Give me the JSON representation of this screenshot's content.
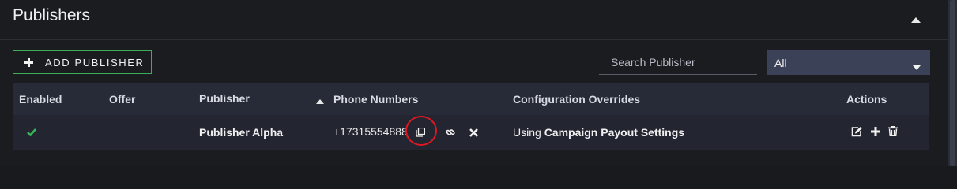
{
  "panel": {
    "title": "Publishers"
  },
  "toolbar": {
    "add_label": "ADD PUBLISHER",
    "search_placeholder": "Search Publisher",
    "filter_value": "All"
  },
  "table": {
    "columns": [
      "Enabled",
      "Offer",
      "Publisher",
      "Phone Numbers",
      "Configuration Overrides",
      "Actions"
    ],
    "sorted_column": "Publisher",
    "sort_direction": "ascending",
    "rows": [
      {
        "enabled": true,
        "offer": "",
        "publisher": "Publisher Alpha",
        "phone": "+17315554888",
        "config_prefix": "Using",
        "config_value": "Campaign Payout Settings"
      }
    ]
  },
  "colors": {
    "accent_green": "#3cae5a",
    "highlight_ring": "#e01722",
    "header_bg": "#272b38",
    "row_bg": "#232631"
  },
  "icons": {
    "collapse": "chevron-up-icon",
    "add": "plus-icon",
    "dropdown": "caret-down-icon",
    "sort": "sort-ascending-icon",
    "enabled": "checkmark-icon",
    "copy": "copy-icon",
    "link": "link-icon",
    "remove": "close-icon",
    "edit": "edit-icon",
    "add_row": "plus-icon",
    "delete": "trash-icon"
  }
}
